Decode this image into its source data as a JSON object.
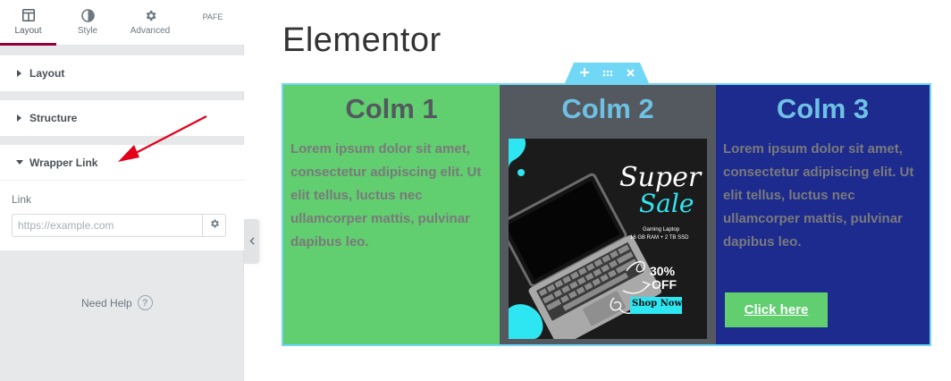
{
  "panel": {
    "tabs": [
      {
        "label": "Layout",
        "icon": "columns-icon",
        "active": true
      },
      {
        "label": "Style",
        "icon": "half-circle-icon",
        "active": false
      },
      {
        "label": "Advanced",
        "icon": "gear-icon",
        "active": false
      },
      {
        "label": "PAFE",
        "icon": "",
        "active": false
      }
    ],
    "sections": [
      {
        "title": "Layout",
        "expanded": false
      },
      {
        "title": "Structure",
        "expanded": false
      },
      {
        "title": "Wrapper Link",
        "expanded": true
      }
    ],
    "link": {
      "label": "Link",
      "value": "",
      "placeholder": "https://example.com"
    },
    "help": {
      "label": "Need Help",
      "icon": "question-circle-icon"
    }
  },
  "canvas": {
    "page_title": "Elementor",
    "section_handle": {
      "add": "+",
      "drag": "drag-dots-icon",
      "close": "×"
    },
    "columns": [
      {
        "title": "Colm 1",
        "text": "Lorem ipsum dolor sit amet, consectetur adipiscing elit. Ut elit tellus, luctus nec ullamcorper mattis, pulvinar dapibus leo."
      },
      {
        "title": "Colm 2",
        "image": {
          "super": "Super",
          "sale": "Sale",
          "line1": "Gaming Laptop",
          "line2": "16 GB RAM + 2 TB SSD",
          "percent": "30%",
          "off": "OFF",
          "shop": "Shop Now"
        }
      },
      {
        "title": "Colm 3",
        "text": "Lorem ipsum dolor sit amet, consectetur adipiscing elit. Ut elit tellus, luctus nec ullamcorper mattis, pulvinar dapibus leo.",
        "button": "Click here"
      }
    ]
  },
  "colors": {
    "accent": "#93003c",
    "green": "#61ce70",
    "gray": "#54595f",
    "navy": "#1d2b8f",
    "light_blue": "#6ec1e4",
    "annotation_arrow": "#e3001b"
  }
}
